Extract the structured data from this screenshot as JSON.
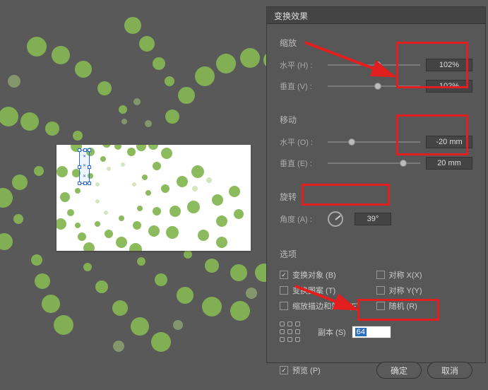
{
  "dialog": {
    "title": "变换效果",
    "scale": {
      "label": "缩放",
      "h_label": "水平 (H) :",
      "h_val": "102%",
      "v_label": "垂直 (V) :",
      "v_val": "102%"
    },
    "move": {
      "label": "移动",
      "h_label": "水平 (O) :",
      "h_val": "-20 mm",
      "v_label": "垂直 (E) :",
      "v_val": "20 mm"
    },
    "rotate": {
      "label": "旋转",
      "angle_label": "角度 (A) :",
      "angle_val": "39°",
      "angle_deg": 39
    },
    "options": {
      "label": "选项",
      "transform_obj": {
        "label": "变换对象 (B)",
        "checked": true
      },
      "mirror_x": {
        "label": "对称 X(X)",
        "checked": false
      },
      "transform_pat": {
        "label": "变换图案 (T)",
        "checked": false
      },
      "mirror_y": {
        "label": "对称 Y(Y)",
        "checked": false
      },
      "scale_sf": {
        "label": "缩放描边和效果 (F)",
        "checked": false
      },
      "random": {
        "label": "随机 (R)",
        "checked": false
      },
      "copies_label": "副本 (S)",
      "copies_val": "64"
    },
    "preview": {
      "label": "预览 (P)",
      "checked": true
    },
    "ok": "确定",
    "cancel": "取消"
  }
}
